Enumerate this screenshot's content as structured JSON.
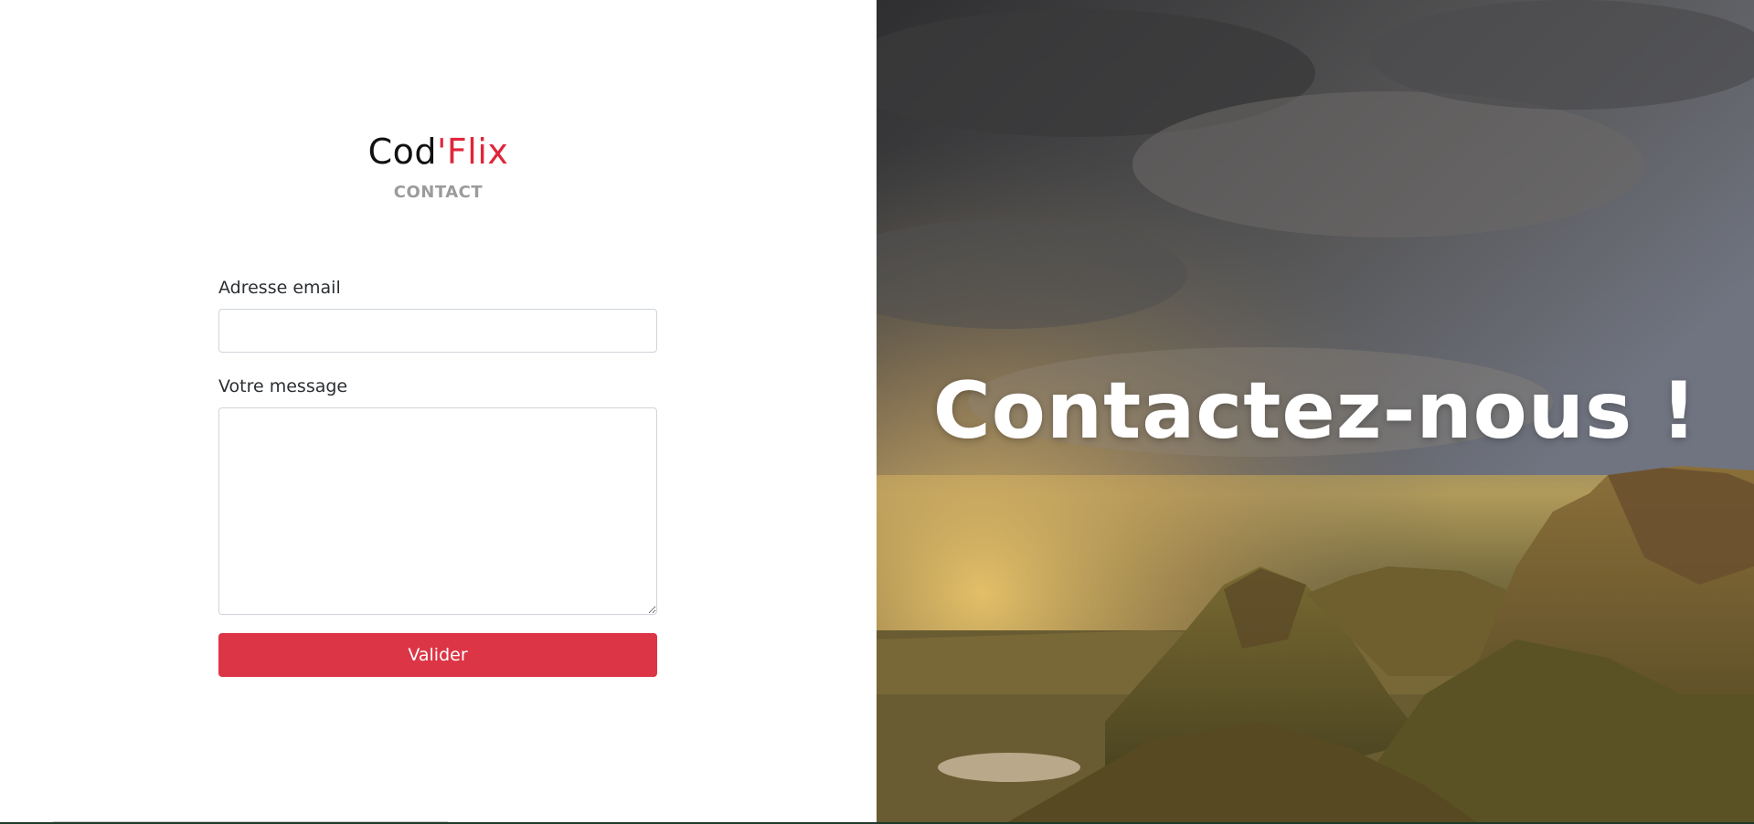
{
  "brand": {
    "part1": "Cod",
    "part2": "'Flix"
  },
  "page_subtitle": "CONTACT",
  "form": {
    "email_label": "Adresse email",
    "email_value": "",
    "message_label": "Votre message",
    "message_value": "",
    "submit_label": "Valider"
  },
  "hero": {
    "title": "Contactez-nous !"
  },
  "colors": {
    "accent": "#e0263a",
    "button": "#dc3545"
  }
}
